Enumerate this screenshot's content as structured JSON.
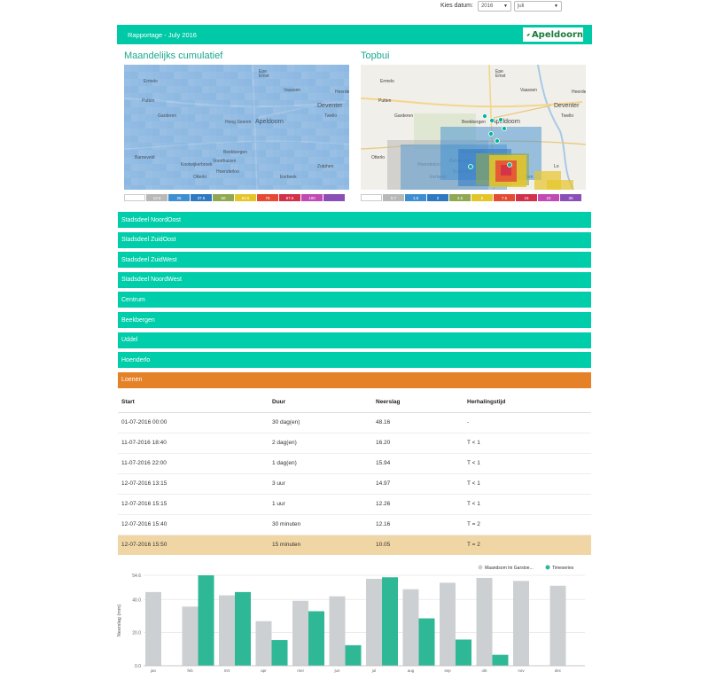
{
  "datepicker": {
    "label": "Kies datum:",
    "year": "2016",
    "month": "juli"
  },
  "header": {
    "title": "Rapportage - July 2016",
    "logo_text": "Apeldoorn"
  },
  "maps": {
    "left": {
      "title": "Maandelijks cumulatief",
      "places": [
        "Epe",
        "Emst",
        "Vaassen",
        "Heerde",
        "Ermelo",
        "Putten",
        "Garderen",
        "Apeldoorn",
        "Deventer",
        "Twello",
        "Hoog Soeren",
        "Beekbergen",
        "Voorthuizen",
        "Barneveld",
        "Kootwijkerbroek",
        "Otterlo",
        "Hoenderloo",
        "Eerbeek",
        "Brummen",
        "Zutphen"
      ],
      "legend": [
        {
          "label": "",
          "color": "#ffffff"
        },
        {
          "label": "12.5",
          "color": "#b8b8b8"
        },
        {
          "label": "25",
          "color": "#3e8fd1"
        },
        {
          "label": "37.5",
          "color": "#2f79c2"
        },
        {
          "label": "50",
          "color": "#90a852"
        },
        {
          "label": "62.5",
          "color": "#e5c62a"
        },
        {
          "label": "75",
          "color": "#e54a33"
        },
        {
          "label": "87.5",
          "color": "#d3304a"
        },
        {
          "label": "100",
          "color": "#c14ab4"
        },
        {
          "label": "",
          "color": "#8b4fb8"
        }
      ]
    },
    "right": {
      "title": "Topbui",
      "places": [
        "Epe",
        "Emst",
        "Vaassen",
        "Heerde",
        "Ermelo",
        "Putten",
        "Garderen",
        "Apeldoorn",
        "Deventer",
        "Twello",
        "Beekbergen",
        "Voorthuizen",
        "Barneveld",
        "Otterlo",
        "Hoenderloo",
        "Eerbeek",
        "Brummen",
        "Zutphen",
        "Eefde",
        "Lo"
      ],
      "legend": [
        {
          "label": "",
          "color": "#ffffff"
        },
        {
          "label": "0.7",
          "color": "#b8b8b8"
        },
        {
          "label": "1.5",
          "color": "#3e8fd1"
        },
        {
          "label": "2",
          "color": "#2f79c2"
        },
        {
          "label": "3.5",
          "color": "#90a852"
        },
        {
          "label": "5",
          "color": "#e5c62a"
        },
        {
          "label": "7.5",
          "color": "#e54a33"
        },
        {
          "label": "15",
          "color": "#d3304a"
        },
        {
          "label": "22",
          "color": "#c14ab4"
        },
        {
          "label": "30",
          "color": "#8b4fb8"
        }
      ]
    }
  },
  "districts": [
    {
      "label": "Stadsdeel NoordOost"
    },
    {
      "label": "Stadsdeel ZuidOost"
    },
    {
      "label": "Stadsdeel ZuidWest"
    },
    {
      "label": "Stadsdeel NoordWest"
    },
    {
      "label": "Centrum"
    },
    {
      "label": "Beekbergen"
    },
    {
      "label": "Uddel"
    },
    {
      "label": "Hoenderlo"
    },
    {
      "label": "Loenen"
    }
  ],
  "events_table": {
    "headers": [
      "Start",
      "Duur",
      "Neerslag",
      "Herhalingstijd"
    ],
    "rows": [
      [
        "01-07-2016 00:00",
        "30 dag(en)",
        "48.16",
        "-"
      ],
      [
        "11-07-2016 18:40",
        "2 dag(en)",
        "16.20",
        "T < 1"
      ],
      [
        "11-07-2016 22:00",
        "1 dag(en)",
        "15.94",
        "T < 1"
      ],
      [
        "12-07-2016 13:15",
        "3 uur",
        "14.97",
        "T < 1"
      ],
      [
        "12-07-2016 15:15",
        "1 uur",
        "12.26",
        "T < 1"
      ],
      [
        "12-07-2016 15:40",
        "30 minuten",
        "12.16",
        "T = 2"
      ],
      [
        "12-07-2016 15:50",
        "15 minuten",
        "10.05",
        "T = 2"
      ]
    ]
  },
  "chart_data": {
    "type": "bar",
    "ylabel": "Neerslag (mm)",
    "ylim": [
      0,
      54.6
    ],
    "yticks": [
      "0.0",
      "20.0",
      "40.0",
      "54.6"
    ],
    "categories": [
      "jan",
      "feb",
      "mrt",
      "apr",
      "mei",
      "jun",
      "jul",
      "aug",
      "sep",
      "okt",
      "nov",
      "dec"
    ],
    "legend_position": "top-right",
    "series": [
      {
        "name": "Maandsom Ini Garstoe...",
        "color": "#cdd0d2",
        "values": [
          44.5,
          35.7,
          42.5,
          26.9,
          39.2,
          41.9,
          52.5,
          46.2,
          50.1,
          53.0,
          51.2,
          48.3
        ]
      },
      {
        "name": "Timeseries",
        "color": "#2fb896",
        "values": [
          null,
          54.6,
          44.5,
          15.5,
          32.9,
          12.4,
          53.4,
          28.6,
          15.8,
          6.6,
          null,
          null
        ]
      }
    ]
  }
}
